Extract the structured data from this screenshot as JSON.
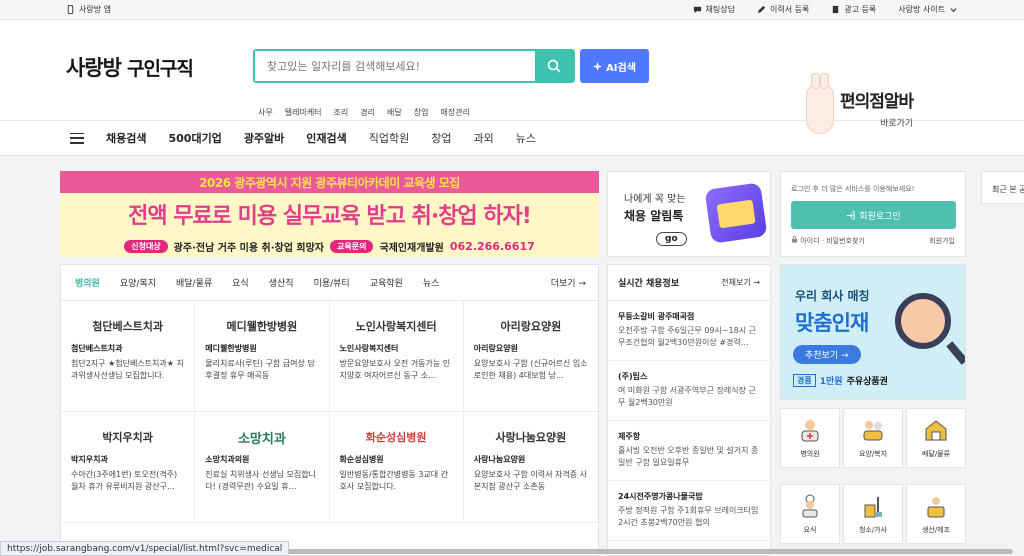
{
  "utilbar": {
    "app_link": "사랑방 앱",
    "chat": "채팅상담",
    "resume": "이력서 등록",
    "ad": "광고 등록",
    "sites": "사랑방 사이트"
  },
  "header": {
    "logo_brand": "사랑방",
    "logo_sub": "구인구직",
    "search_placeholder": "찾고있는 일자리를 검색해보세요!",
    "ai_search": "AI검색",
    "keywords": [
      "사무",
      "텔레마케터",
      "조리",
      "경리",
      "배달",
      "창업",
      "매장관리"
    ],
    "banner_title": "편의점알바",
    "banner_sub": "바로가기"
  },
  "nav": {
    "items": [
      "채용검색",
      "500대기업",
      "광주알바",
      "인재검색",
      "직업학원",
      "창업",
      "과외",
      "뉴스"
    ]
  },
  "promo": {
    "top": "2026 광주광역시 지원 광주뷰티아카데미 교육생 모집",
    "main": "전액 무료로 미용 실무교육 받고 취·창업 하자!",
    "target_label": "신청대상",
    "target": "광주·전남 거주 미용 취·창업 희망자",
    "contact_label": "교육문의",
    "contact": "국제인재개발원",
    "phone": "062.266.6617"
  },
  "alim": {
    "line1": "나에게 꼭 맞는",
    "line2": "채용 알림톡",
    "go": "go"
  },
  "login": {
    "message": "로그인 후 더 많은 서비스를 이용해보세요!",
    "button": "회원로그인",
    "find": "아이디 · 비밀번호찾기",
    "join": "회원가입"
  },
  "side": {
    "recent": "최근 본 공"
  },
  "tabs": {
    "items": [
      "병의원",
      "요양/복지",
      "배달/물류",
      "요식",
      "생산직",
      "미용/뷰티",
      "교육학원",
      "뉴스"
    ],
    "more": "더보기"
  },
  "jobs": [
    {
      "logo": "첨단베스트치과",
      "name": "첨단베스트치과",
      "desc": "첨단2지구 ★첨단베스트치과★ 치과위생사선생님 모집합니다."
    },
    {
      "logo": "메디웰한방병원",
      "name": "메디웰한방병원",
      "desc": "물리치료사(루틴) 구함 급여상 담후결정 휴무 매곡동"
    },
    {
      "logo": "노인사랑복지센터",
      "name": "노인사랑복지센터",
      "desc": "방문요양보호사 오전 거동가능 인지양호 여자어르신 동구 소…"
    },
    {
      "logo": "아리랑요양원",
      "name": "아리랑요양원",
      "desc": "요양보호사 구함 (신규어르신 입소로인한 채용) 4대보험 남…"
    },
    {
      "logo": "박지우치과",
      "name": "박지우치과",
      "desc": "수아간(3주에1번) 토오전(격주) 월차 휴가 유류비지원 광산구…"
    },
    {
      "logo": "소망치과",
      "name": "소망치과의원",
      "desc": "진료실 치위생사 선생님 모집합니다! (경력무관) 수요일 휴…"
    },
    {
      "logo": "화순성심병원",
      "name": "화순성심병원",
      "desc": "일반병동/통합간병병동 3교대 간호사 모집합니다."
    },
    {
      "logo": "사랑나눔요양원",
      "name": "사랑나눔요양원",
      "desc": "요양보호사 구함 이력서 자격증 사본지참 광산구 소촌동"
    }
  ],
  "realtime": {
    "title": "실시간 채용정보",
    "more": "전체보기",
    "items": [
      {
        "company": "무등소갈비 광주매곡점",
        "desc": "오전주방 구함 주6일근무 09시~18시 근무조건협의 월2백30만원이상 #경력…"
      },
      {
        "company": "(주)팁스",
        "desc": "여 미화원 구함 서광주역부근 장례식장 근무 월2백30만원"
      },
      {
        "company": "제주항",
        "desc": "홀서빙 오전반 오후반 종일반 및 설거지 종일반 구함 일요일휴무"
      },
      {
        "company": "24시전주명가콩나물국밥",
        "desc": "주방 정직원 구함 주1회휴무 브레이크타임2시간 초봉2백70만원 협의"
      }
    ]
  },
  "ad_match": {
    "line1": "우리 회사 매칭",
    "line2": "맞춤인재",
    "button": "추천보기",
    "cash": "경품",
    "amount": "1만원",
    "suffix": "주유상품권"
  },
  "categories": [
    "병의원",
    "요양/복지",
    "배달/물류",
    "요식",
    "청소/가사",
    "생산/제조"
  ],
  "status_url": "https://job.sarangbang.com/v1/special/list.html?svc=medical",
  "colors": {
    "accent": "#3fc2ad",
    "ai_button": "#4f79ff",
    "promo_pink": "#e1468e",
    "ad_blue": "#1f6fd2"
  }
}
